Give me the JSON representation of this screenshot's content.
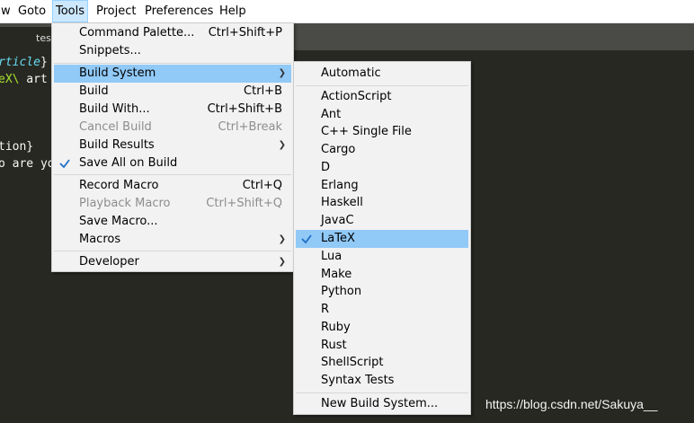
{
  "menubar": {
    "items": [
      "w",
      "Goto",
      "Tools",
      "Project",
      "Preferences",
      "Help"
    ]
  },
  "tabs": {
    "file_tab": "test"
  },
  "editor": {
    "lines": [
      {
        "pre": "",
        "a": "rticle",
        "b": "}"
      },
      {
        "pre": "",
        "a": "eX\\",
        "b": " art"
      },
      {
        "pre": "",
        "a": "",
        "b": ""
      },
      {
        "pre": "",
        "a": "",
        "b": ""
      },
      {
        "pre": "tion}",
        "a": "",
        "b": ""
      },
      {
        "pre": "o are yo",
        "a": "",
        "b": ""
      }
    ]
  },
  "tools_menu": {
    "items": [
      {
        "label": "Command Palette...",
        "shortcut": "Ctrl+Shift+P"
      },
      {
        "label": "Snippets...",
        "shortcut": ""
      },
      {
        "label": "Build System",
        "shortcut": "",
        "submenu": true,
        "highlighted": true
      },
      {
        "label": "Build",
        "shortcut": "Ctrl+B"
      },
      {
        "label": "Build With...",
        "shortcut": "Ctrl+Shift+B"
      },
      {
        "label": "Cancel Build",
        "shortcut": "Ctrl+Break",
        "disabled": true
      },
      {
        "label": "Build Results",
        "shortcut": "",
        "submenu": true
      },
      {
        "label": "Save All on Build",
        "shortcut": "",
        "checked": true
      },
      {
        "label": "Record Macro",
        "shortcut": "Ctrl+Q"
      },
      {
        "label": "Playback Macro",
        "shortcut": "Ctrl+Shift+Q",
        "disabled": true
      },
      {
        "label": "Save Macro...",
        "shortcut": ""
      },
      {
        "label": "Macros",
        "shortcut": "",
        "submenu": true
      },
      {
        "label": "Developer",
        "shortcut": "",
        "submenu": true
      }
    ]
  },
  "build_system_menu": {
    "items": [
      {
        "label": "Automatic"
      },
      {
        "label": "ActionScript"
      },
      {
        "label": "Ant"
      },
      {
        "label": "C++ Single File"
      },
      {
        "label": "Cargo"
      },
      {
        "label": "D"
      },
      {
        "label": "Erlang"
      },
      {
        "label": "Haskell"
      },
      {
        "label": "JavaC"
      },
      {
        "label": "LaTeX",
        "checked": true,
        "highlighted": true
      },
      {
        "label": "Lua"
      },
      {
        "label": "Make"
      },
      {
        "label": "Python"
      },
      {
        "label": "R"
      },
      {
        "label": "Ruby"
      },
      {
        "label": "Rust"
      },
      {
        "label": "ShellScript"
      },
      {
        "label": "Syntax Tests"
      },
      {
        "label": "New Build System..."
      }
    ]
  },
  "watermark": "https://blog.csdn.net/Sakuya__",
  "colors": {
    "editor_bg": "#272822",
    "menu_bg": "#f2f2f2",
    "highlight": "#91c9f7",
    "check_color": "#1e6fc5"
  }
}
